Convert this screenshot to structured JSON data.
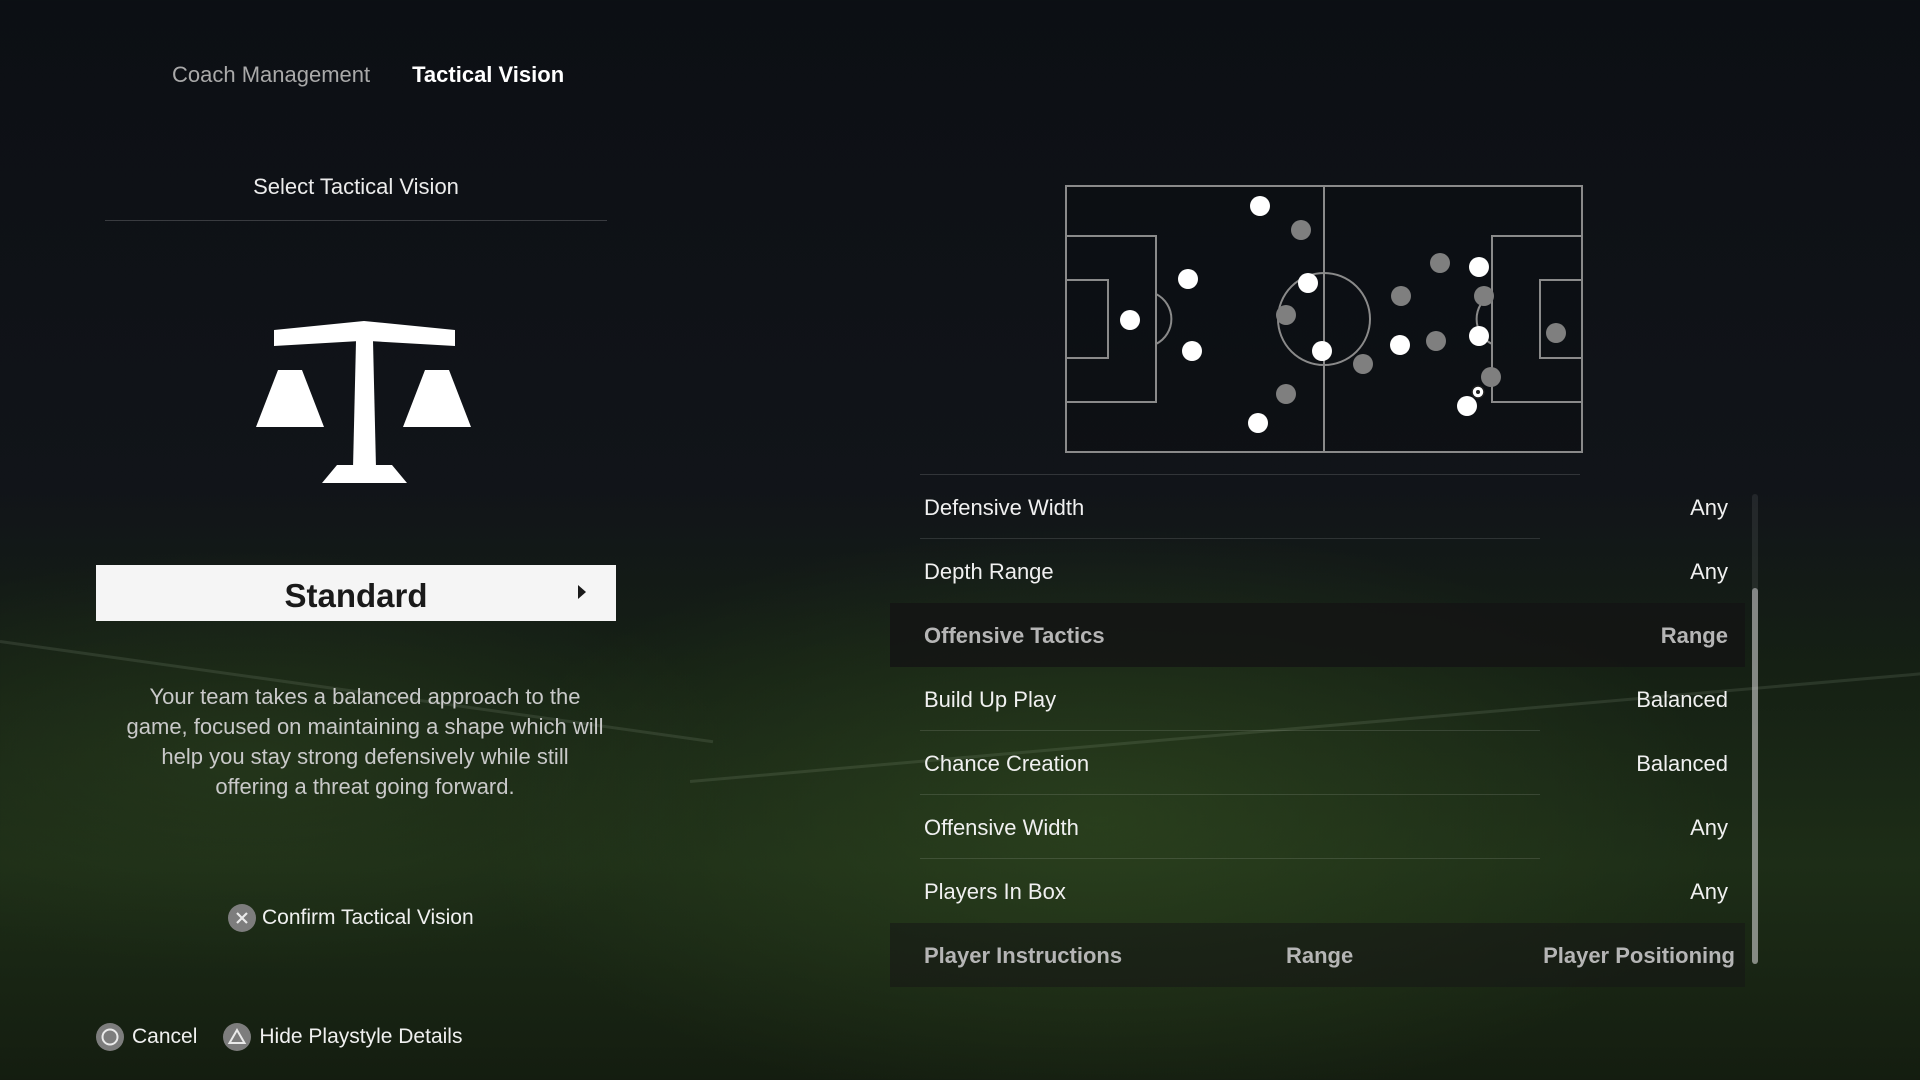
{
  "tabs": [
    {
      "label": "Coach Management",
      "active": false
    },
    {
      "label": "Tactical Vision",
      "active": true
    }
  ],
  "left_panel": {
    "heading": "Select Tactical Vision",
    "vision_icon": "balance-scale-icon",
    "selected_vision": "Standard",
    "description": "Your team takes a balanced approach to the game, focused on maintaining a shape which will help you stay strong defensively while still offering a threat going forward.",
    "confirm": {
      "glyph": "cross-button-icon",
      "label": "Confirm Tactical Vision"
    }
  },
  "footer": [
    {
      "glyph": "circle-button-icon",
      "label": "Cancel"
    },
    {
      "glyph": "triangle-button-icon",
      "label": "Hide Playstyle Details"
    }
  ],
  "pitch_preview": {
    "ball_icon": "soccer-ball-icon"
  },
  "settings": {
    "rows": [
      {
        "label": "Defensive Width",
        "value": "Any"
      },
      {
        "label": "Depth Range",
        "value": "Any"
      },
      {
        "label": "Offensive Tactics",
        "value": "Range",
        "section": true
      },
      {
        "label": "Build Up Play",
        "value": "Balanced"
      },
      {
        "label": "Chance Creation",
        "value": "Balanced"
      },
      {
        "label": "Offensive Width",
        "value": "Any"
      },
      {
        "label": "Players In Box",
        "value": "Any"
      }
    ],
    "instructions": {
      "label": "Player Instructions",
      "middle": "Range",
      "value": "Player Positioning"
    }
  },
  "colors": {
    "highlight": "#f5f5f5",
    "team_player": "#ffffff",
    "opponent_player": "#7f7f7f"
  }
}
